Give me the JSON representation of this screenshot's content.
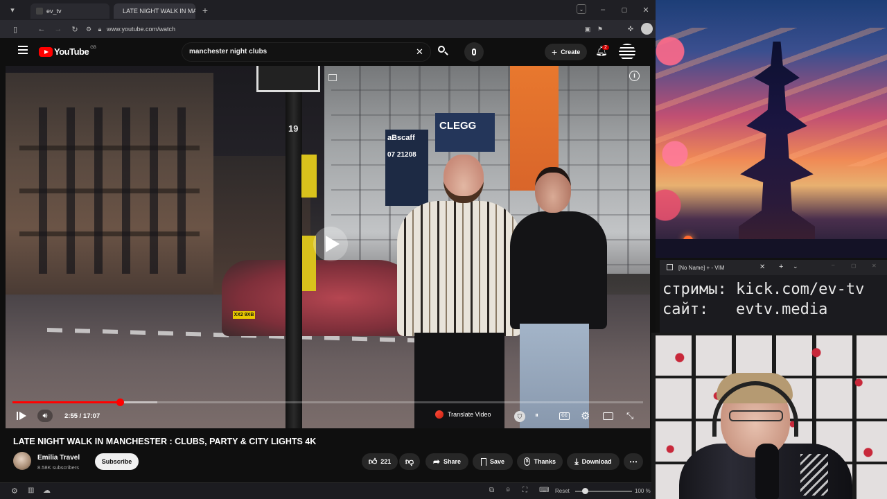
{
  "browser": {
    "tabs": [
      {
        "label": "ev_tv",
        "active": false
      },
      {
        "label": "LATE NIGHT WALK IN MAI",
        "active": true
      }
    ],
    "url": "www.youtube.com/watch"
  },
  "youtube": {
    "logo_text": "YouTube",
    "logo_superscript": "GB",
    "search_query": "manchester night clubs",
    "create_label": "Create",
    "notifications_count": "2",
    "player": {
      "time": "2:55 / 17:07",
      "progress": 0.17,
      "translate_label": "Translate Video"
    },
    "video_title": "LATE NIGHT WALK IN MANCHESTER : CLUBS, PARTY & CITY LIGHTS 4K",
    "channel_name": "Emilia Travel",
    "subscribers": "8.58K subscribers",
    "subscribe_label": "Subscribe",
    "likes": "221",
    "share_label": "Share",
    "save_label": "Save",
    "thanks_label": "Thanks",
    "download_label": "Download"
  },
  "video_scene_text": {
    "sign_clegg": "CLEGG",
    "sign_scaff": "aBscaff",
    "sign_phone": "07 21208",
    "pole_number": "19",
    "plate": "XX2 9XB"
  },
  "statusbar": {
    "reset_label": "Reset",
    "zoom": "100 %"
  },
  "vim": {
    "title": "[No Name] + - VIM",
    "line1": "стримы: kick.com/ev-tv",
    "line2": "сайт:   evtv.media"
  },
  "colors": {
    "youtube_red": "#ff0000",
    "bg": "#0f0f0f",
    "pill": "#272727"
  }
}
